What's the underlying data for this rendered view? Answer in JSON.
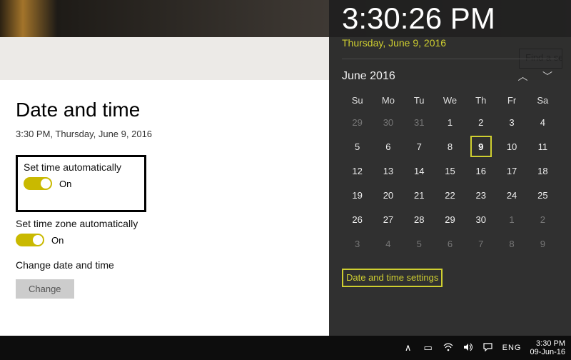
{
  "header": {
    "search_text": "Find a se"
  },
  "settings": {
    "title": "Date and time",
    "now": "3:30 PM, Thursday, June 9, 2016",
    "set_time_auto": {
      "label": "Set time automatically",
      "state": "On"
    },
    "set_tz_auto": {
      "label": "Set time zone automatically",
      "state": "On"
    },
    "change_section": "Change date and time",
    "change_btn": "Change"
  },
  "flyout": {
    "clock": "3:30:26 PM",
    "date": "Thursday, June 9, 2016",
    "month_label": "June 2016",
    "dow": [
      "Su",
      "Mo",
      "Tu",
      "We",
      "Th",
      "Fr",
      "Sa"
    ],
    "weeks": [
      [
        {
          "d": "29",
          "dim": true
        },
        {
          "d": "30",
          "dim": true
        },
        {
          "d": "31",
          "dim": true
        },
        {
          "d": "1"
        },
        {
          "d": "2"
        },
        {
          "d": "3"
        },
        {
          "d": "4"
        }
      ],
      [
        {
          "d": "5"
        },
        {
          "d": "6"
        },
        {
          "d": "7"
        },
        {
          "d": "8"
        },
        {
          "d": "9",
          "today": true
        },
        {
          "d": "10"
        },
        {
          "d": "11"
        }
      ],
      [
        {
          "d": "12"
        },
        {
          "d": "13"
        },
        {
          "d": "14"
        },
        {
          "d": "15"
        },
        {
          "d": "16"
        },
        {
          "d": "17"
        },
        {
          "d": "18"
        }
      ],
      [
        {
          "d": "19"
        },
        {
          "d": "20"
        },
        {
          "d": "21"
        },
        {
          "d": "22"
        },
        {
          "d": "23"
        },
        {
          "d": "24"
        },
        {
          "d": "25"
        }
      ],
      [
        {
          "d": "26"
        },
        {
          "d": "27"
        },
        {
          "d": "28"
        },
        {
          "d": "29"
        },
        {
          "d": "30"
        },
        {
          "d": "1",
          "dim": true
        },
        {
          "d": "2",
          "dim": true
        }
      ],
      [
        {
          "d": "3",
          "dim": true
        },
        {
          "d": "4",
          "dim": true
        },
        {
          "d": "5",
          "dim": true
        },
        {
          "d": "6",
          "dim": true
        },
        {
          "d": "7",
          "dim": true
        },
        {
          "d": "8",
          "dim": true
        },
        {
          "d": "9",
          "dim": true
        }
      ]
    ],
    "link": "Date and time settings"
  },
  "taskbar": {
    "lang": "ENG",
    "time": "3:30 PM",
    "date": "09-Jun-16"
  }
}
